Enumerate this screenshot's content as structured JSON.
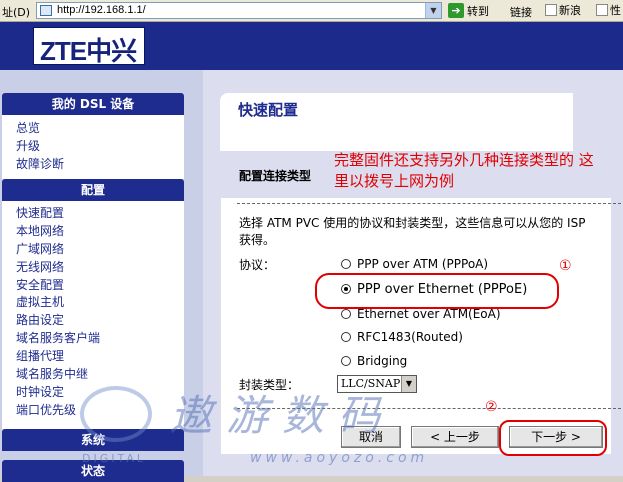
{
  "browser": {
    "address_label": "址(D)",
    "url": "http://192.168.1.1/",
    "go_label": "转到",
    "links_label": "链接",
    "news_label": "新浪",
    "more_label": "性"
  },
  "header": {
    "logo": "ZTE中兴"
  },
  "sidebar": {
    "section1": {
      "title": "我的 DSL 设备",
      "items": [
        "总览",
        "升级",
        "故障诊断"
      ]
    },
    "section2": {
      "title": "配置",
      "items": [
        "快速配置",
        "本地网络",
        "广域网络",
        "无线网络",
        "安全配置",
        "虚拟主机",
        "路由设定",
        "域名服务客户端",
        "组播代理",
        "域名服务中继",
        "时钟设定",
        "端口优先级"
      ]
    },
    "section3": {
      "title": "系统"
    },
    "section4": {
      "title": "状态"
    }
  },
  "main": {
    "title": "快速配置",
    "section_label": "配置连接类型",
    "annotation_note": "完整固件还支持另外几种连接类型的 这里以拨号上网为例",
    "description": "选择 ATM PVC 使用的协议和封装类型，这些信息可以从您的 ISP 获得。",
    "protocol_label": "协议：",
    "options": [
      {
        "label": "PPP over ATM (PPPoA)",
        "selected": false
      },
      {
        "label": "PPP over Ethernet (PPPoE)",
        "selected": true
      },
      {
        "label": "Ethernet over ATM(EoA)",
        "selected": false
      },
      {
        "label": "RFC1483(Routed)",
        "selected": false
      },
      {
        "label": "Bridging",
        "selected": false
      }
    ],
    "encap_label": "封装类型：",
    "encap_value": "LLC/SNAP",
    "marker1": "①",
    "marker2": "②",
    "buttons": {
      "cancel": "取消",
      "prev": "< 上一步",
      "next": "下一步 >"
    }
  },
  "watermark": {
    "text": "遨游数码",
    "url": "www.aoyozo.com",
    "digital": "DIGITAL"
  },
  "colors": {
    "header_bg": "#1c2a8c",
    "accent_red": "#e00000",
    "sidebar_bg": "#c9cfe6",
    "main_bg": "#dcdef0"
  }
}
